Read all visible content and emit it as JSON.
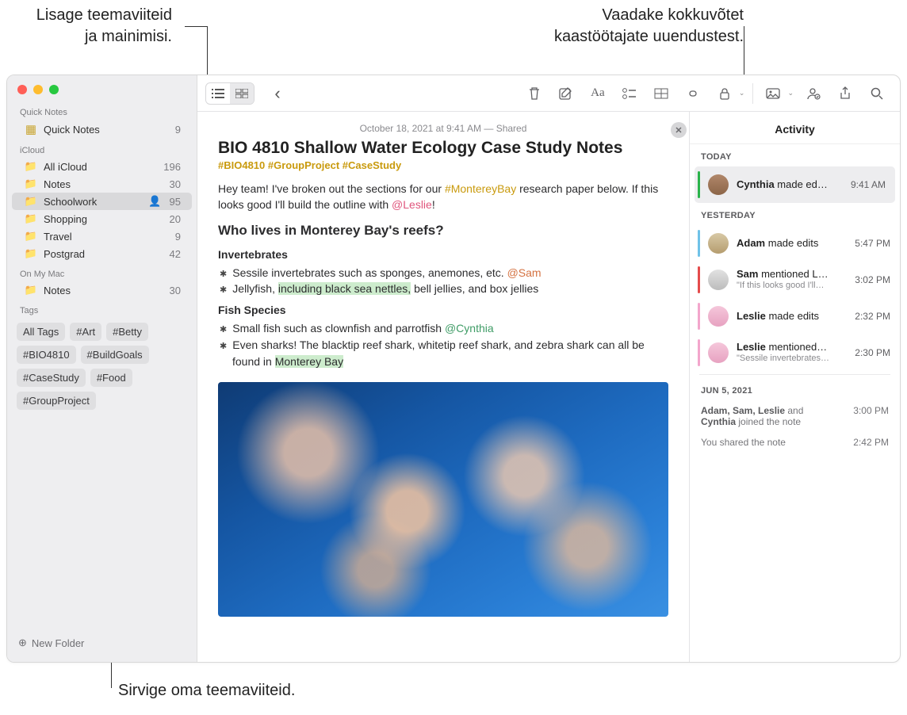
{
  "callouts": {
    "top_left_l1": "Lisage teemaviiteid",
    "top_left_l2": "ja mainimisi.",
    "top_right_l1": "Vaadake kokkuvõtet",
    "top_right_l2": "kaastöötajate uuendustest.",
    "bottom": "Sirvige oma teemaviiteid."
  },
  "sidebar": {
    "quick_notes_section": "Quick Notes",
    "quick_notes_item": "Quick Notes",
    "quick_notes_count": "9",
    "icloud_section": "iCloud",
    "folders": [
      {
        "label": "All iCloud",
        "count": "196",
        "shared": false
      },
      {
        "label": "Notes",
        "count": "30",
        "shared": false
      },
      {
        "label": "Schoolwork",
        "count": "95",
        "shared": true,
        "selected": true
      },
      {
        "label": "Shopping",
        "count": "20",
        "shared": false
      },
      {
        "label": "Travel",
        "count": "9",
        "shared": false
      },
      {
        "label": "Postgrad",
        "count": "42",
        "shared": false
      }
    ],
    "on_my_mac_section": "On My Mac",
    "on_my_mac_item": "Notes",
    "on_my_mac_count": "30",
    "tags_section": "Tags",
    "tags": [
      "All Tags",
      "#Art",
      "#Betty",
      "#BIO4810",
      "#BuildGoals",
      "#CaseStudy",
      "#Food",
      "#GroupProject"
    ],
    "new_folder": "New Folder"
  },
  "toolbar": {
    "back": "‹",
    "format_label": "Aa"
  },
  "note": {
    "meta": "October 18, 2021 at 9:41 AM — Shared",
    "title": "BIO 4810 Shallow Water Ecology Case Study Notes",
    "tags": "#BIO4810 #GroupProject #CaseStudy",
    "intro_1a": "Hey team! I've broken out the sections for our ",
    "intro_hash": "#MontereyBay",
    "intro_1b": " research paper below. If this looks good I'll build the outline with ",
    "intro_mention": "@Leslie",
    "intro_1c": "!",
    "h2": "Who lives in Monterey Bay's reefs?",
    "h3_inv": "Invertebrates",
    "inv_li1_a": "Sessile invertebrates such as sponges, anemones, etc. ",
    "inv_li1_m": "@Sam",
    "inv_li2_a": "Jellyfish, ",
    "inv_li2_hl": "including black sea nettles,",
    "inv_li2_b": " bell jellies, and box jellies",
    "h3_fish": "Fish Species",
    "fish_li1_a": "Small fish such as clownfish and parrotfish ",
    "fish_li1_m": "@Cynthia",
    "fish_li2_a": "Even sharks! The blacktip reef shark, whitetip reef shark, and zebra shark can all be found in ",
    "fish_li2_hl": "Monterey Bay"
  },
  "activity": {
    "header": "Activity",
    "today_label": "TODAY",
    "yesterday_label": "YESTERDAY",
    "jun5_label": "JUN 5, 2021",
    "today": [
      {
        "who": "Cynthia",
        "rest": " made ed…",
        "time": "9:41 AM",
        "bar": "#2ab34a",
        "av": "av-cyn"
      }
    ],
    "yesterday": [
      {
        "who": "Adam",
        "rest": " made edits",
        "time": "5:47 PM",
        "bar": "#6fc2e8",
        "av": "av-adam"
      },
      {
        "who": "Sam",
        "rest": " mentioned L…",
        "sub": "\"If this looks good I'll…",
        "time": "3:02 PM",
        "bar": "#e44b4b",
        "av": "av-sam"
      },
      {
        "who": "Leslie",
        "rest": " made edits",
        "time": "2:32 PM",
        "bar": "#f3a6cc",
        "av": "av-les"
      },
      {
        "who": "Leslie",
        "rest": " mentioned…",
        "sub": "\"Sessile invertebrates…",
        "time": "2:30 PM",
        "bar": "#f3a6cc",
        "av": "av-les"
      }
    ],
    "jun5": [
      {
        "text_a": "Adam, Sam, Leslie",
        "text_b": " and ",
        "text_c": "Cynthia",
        "text_d": " joined the note",
        "time": "3:00 PM"
      },
      {
        "plain": "You shared the note",
        "time": "2:42 PM"
      }
    ]
  },
  "colors": {
    "hashtag": "#c99a0d",
    "mention_pink": "#e0557c",
    "mention_green": "#3f9c66",
    "mention_orange": "#d47241",
    "highlight_green": "#cdeccd"
  }
}
